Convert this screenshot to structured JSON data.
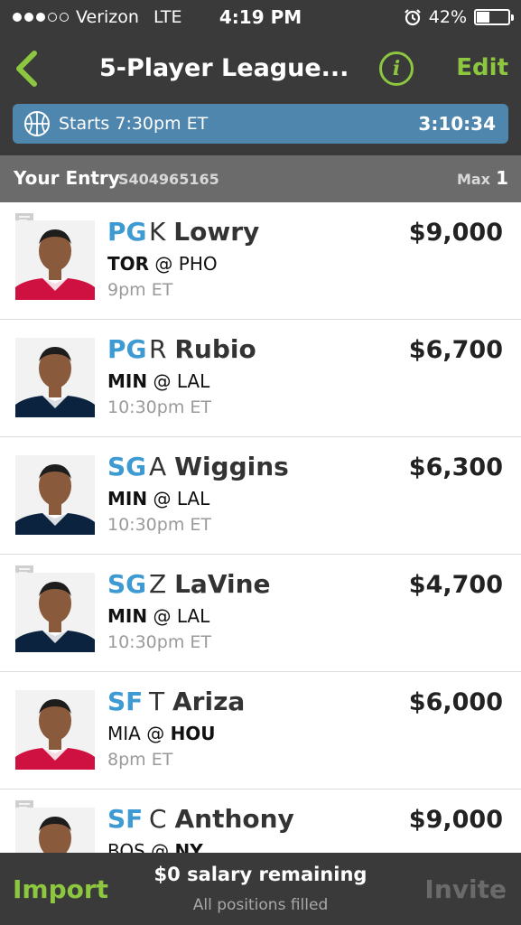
{
  "status_bar": {
    "carrier": "Verizon",
    "network": "LTE",
    "time": "4:19 PM",
    "battery": "42%",
    "battery_level": 0.42,
    "signal_bars_filled": 3,
    "signal_bars_total": 5
  },
  "nav": {
    "title": "5-Player League...",
    "info_label": "i",
    "edit_label": "Edit",
    "accent_color": "#8dc63f"
  },
  "contest": {
    "starts_text": "Starts 7:30pm ET",
    "countdown": "3:10:34",
    "bar_color": "#4e86ad"
  },
  "entry": {
    "label": "Your Entry",
    "id": "S404965165",
    "max_label": "Max",
    "max_value": "1"
  },
  "players": [
    {
      "position": "PG",
      "first_initial": "K",
      "last_name": "Lowry",
      "salary": "$9,000",
      "team_away": "TOR",
      "sep": "@",
      "team_home": "PHO",
      "bold_team": "away",
      "time": "9pm ET",
      "has_note": true,
      "jersey_color": "#ce1141"
    },
    {
      "position": "PG",
      "first_initial": "R",
      "last_name": "Rubio",
      "salary": "$6,700",
      "team_away": "MIN",
      "sep": "@",
      "team_home": "LAL",
      "bold_team": "away",
      "time": "10:30pm ET",
      "has_note": false,
      "jersey_color": "#0c2340"
    },
    {
      "position": "SG",
      "first_initial": "A",
      "last_name": "Wiggins",
      "salary": "$6,300",
      "team_away": "MIN",
      "sep": "@",
      "team_home": "LAL",
      "bold_team": "away",
      "time": "10:30pm ET",
      "has_note": false,
      "jersey_color": "#0c2340"
    },
    {
      "position": "SG",
      "first_initial": "Z",
      "last_name": "LaVine",
      "salary": "$4,700",
      "team_away": "MIN",
      "sep": "@",
      "team_home": "LAL",
      "bold_team": "away",
      "time": "10:30pm ET",
      "has_note": true,
      "jersey_color": "#0c2340"
    },
    {
      "position": "SF",
      "first_initial": "T",
      "last_name": "Ariza",
      "salary": "$6,000",
      "team_away": "MIA",
      "sep": "@",
      "team_home": "HOU",
      "bold_team": "home",
      "time": "8pm ET",
      "has_note": false,
      "jersey_color": "#ce1141"
    },
    {
      "position": "SF",
      "first_initial": "C",
      "last_name": "Anthony",
      "salary": "$9,000",
      "team_away": "BOS",
      "sep": "@",
      "team_home": "NY",
      "bold_team": "home",
      "time": "",
      "has_note": true,
      "jersey_color": "#006bb6"
    }
  ],
  "bottom": {
    "import_label": "Import",
    "salary_remaining": "$0 salary remaining",
    "positions_status": "All positions filled",
    "invite_label": "Invite"
  },
  "icons": {
    "back": "chevron-left-icon",
    "info": "info-icon",
    "sport": "basketball-icon",
    "note": "note-icon",
    "alarm": "alarm-icon"
  }
}
